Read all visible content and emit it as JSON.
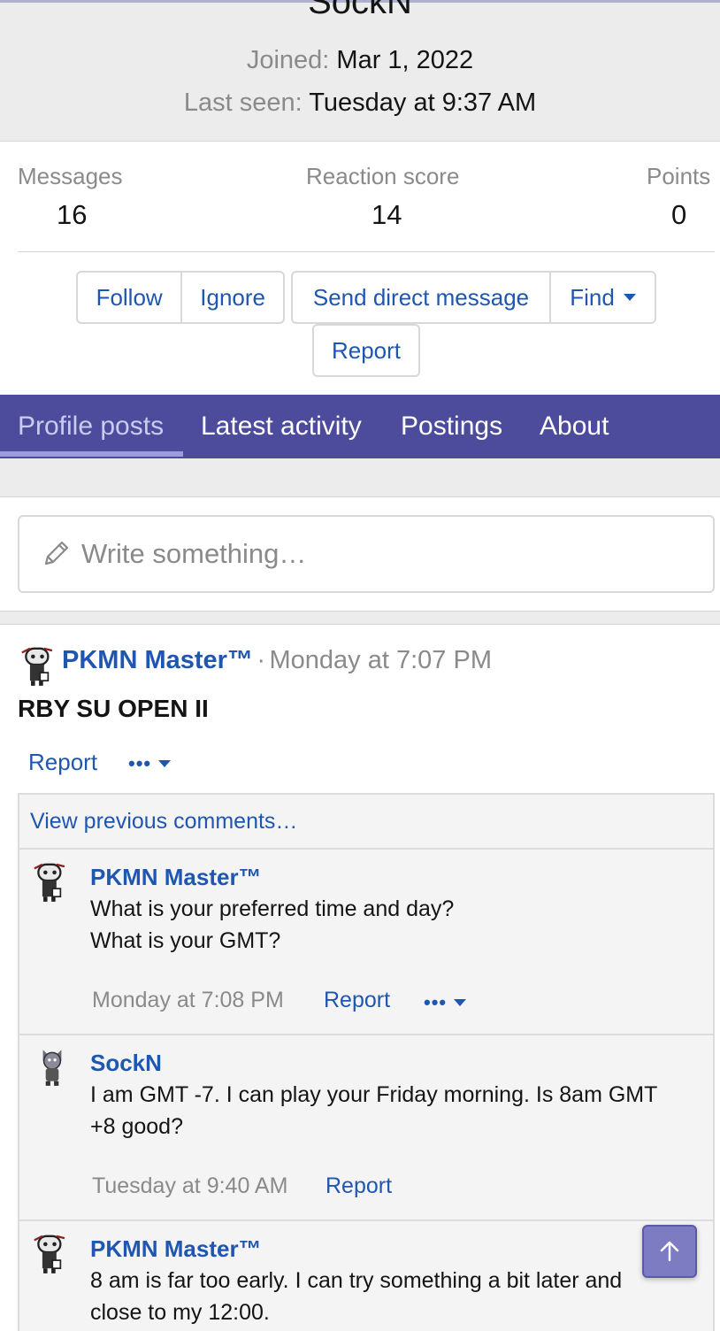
{
  "profile": {
    "username": "SockN",
    "joined_label": "Joined:",
    "joined_value": "Mar 1, 2022",
    "last_seen_label": "Last seen:",
    "last_seen_value": "Tuesday at 9:37 AM"
  },
  "stats": {
    "messages_label": "Messages",
    "messages_value": "16",
    "reaction_label": "Reaction score",
    "reaction_value": "14",
    "points_label": "Points",
    "points_value": "0"
  },
  "actions": {
    "follow": "Follow",
    "ignore": "Ignore",
    "send_dm": "Send direct message",
    "find": "Find",
    "report": "Report"
  },
  "tabs": [
    {
      "label": "Profile posts"
    },
    {
      "label": "Latest activity"
    },
    {
      "label": "Postings"
    },
    {
      "label": "About"
    }
  ],
  "composer": {
    "placeholder": "Write something…"
  },
  "post": {
    "author": "PKMN Master™",
    "separator": "·",
    "time": "Monday at 7:07 PM",
    "body": "RBY SU OPEN II",
    "report": "Report",
    "more": "•••"
  },
  "comments": {
    "view_previous": "View previous comments…",
    "items": [
      {
        "author": "PKMN Master™",
        "line1": "What is your preferred time and day?",
        "line2": "What is your GMT?",
        "time": "Monday at 7:08 PM",
        "report": "Report",
        "more": "•••"
      },
      {
        "author": "SockN",
        "line1": "I am GMT -7. I can play your Friday morning. Is 8am GMT",
        "line2": "+8 good?",
        "time": "Tuesday at 9:40 AM",
        "report": "Report"
      },
      {
        "author": "PKMN Master™",
        "line1": "8 am is far too early. I can try something a bit later and",
        "line2": "close to my 12:00."
      }
    ]
  },
  "colors": {
    "accent": "#1f56b0",
    "tabbar": "#4d4b9c",
    "scroll_button": "#7d7cc3"
  },
  "icons": [
    "pencil-icon",
    "caret-down-icon",
    "arrow-up-icon"
  ]
}
